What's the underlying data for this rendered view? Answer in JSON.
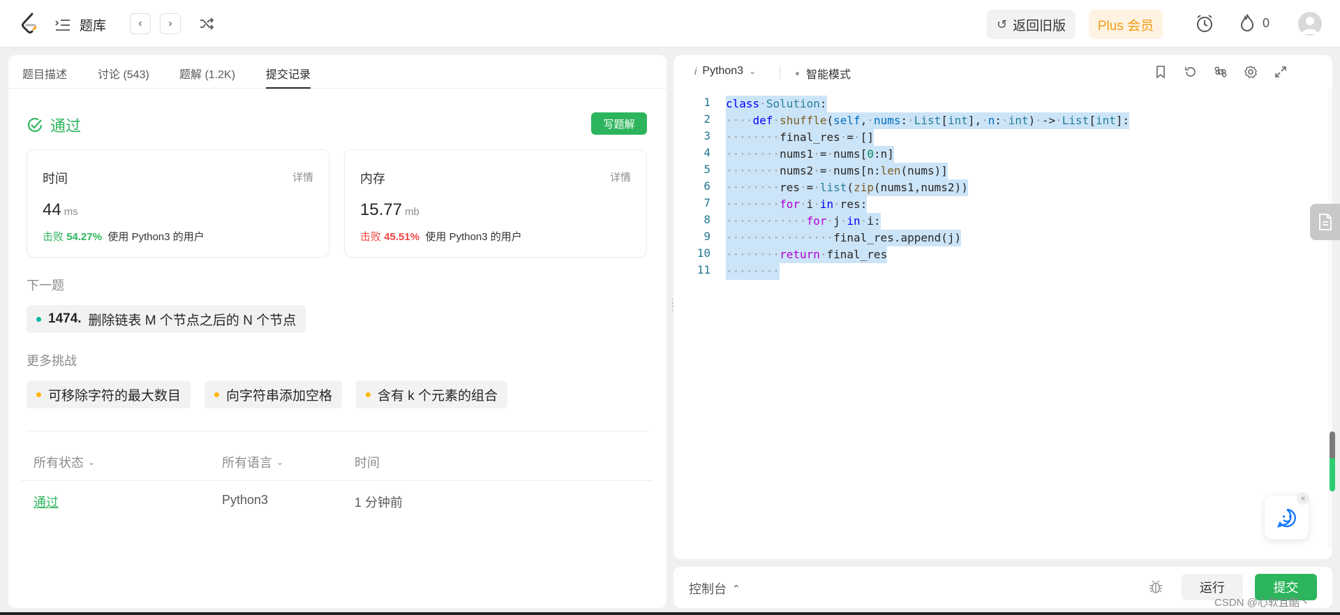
{
  "topbar": {
    "problem_bank": "题库",
    "old_version": "返回旧版",
    "plus": "Plus 会员",
    "streak_count": "0"
  },
  "left": {
    "tabs": [
      {
        "label": "题目描述"
      },
      {
        "label": "讨论 (543)"
      },
      {
        "label": "题解 (1.2K)"
      },
      {
        "label": "提交记录"
      }
    ],
    "status": "通过",
    "write_solution": "写题解",
    "time_card": {
      "title": "时间",
      "detail": "详情",
      "value": "44",
      "unit": "ms",
      "beat_label": "击败",
      "beat_pct": "54.27%",
      "beat_suffix": "使用 Python3 的用户"
    },
    "memory_card": {
      "title": "内存",
      "detail": "详情",
      "value": "15.77",
      "unit": "mb",
      "beat_label": "击败",
      "beat_pct": "45.51%",
      "beat_suffix": "使用 Python3 的用户"
    },
    "next_title": "下一题",
    "next_problem_num": "1474.",
    "next_problem": "删除链表 M 个节点之后的 N 个节点",
    "more_title": "更多挑战",
    "challenges": [
      "可移除字符的最大数目",
      "向字符串添加空格",
      "含有 k 个元素的组合"
    ],
    "table": {
      "headers": [
        "所有状态",
        "所有语言",
        "时间"
      ],
      "row": {
        "status": "通过",
        "lang": "Python3",
        "time": "1 分钟前"
      }
    }
  },
  "editor": {
    "language": "Python3",
    "mode": "智能模式",
    "line_numbers": [
      "1",
      "2",
      "3",
      "4",
      "5",
      "6",
      "7",
      "8",
      "9",
      "10",
      "11"
    ]
  },
  "console": {
    "label": "控制台",
    "run": "运行",
    "submit": "提交"
  },
  "watermark": "CSDN @心软且酷丶",
  "colors": {
    "accent_green": "#2db55d",
    "fail_red": "#ef4743",
    "plus_orange": "#f39c12"
  }
}
